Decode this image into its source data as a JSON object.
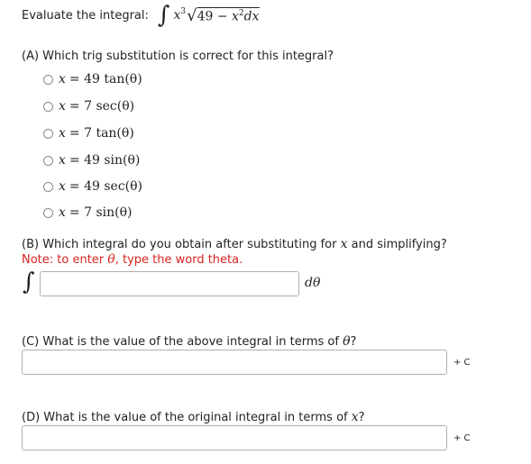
{
  "intro": {
    "label": "Evaluate the integral:",
    "integral_symbol": "∫",
    "var_x": "x",
    "exp3": "3",
    "radical": "√",
    "radicand_const": "49 − ",
    "var_x2": "x",
    "exp2": "2",
    "dx": "dx"
  },
  "partA": {
    "question": "(A) Which trig substitution is correct for this integral?",
    "options": [
      {
        "lhs": "x",
        "rhs": "= 49 tan(θ)"
      },
      {
        "lhs": "x",
        "rhs": "= 7 sec(θ)"
      },
      {
        "lhs": "x",
        "rhs": "= 7 tan(θ)"
      },
      {
        "lhs": "x",
        "rhs": "= 49 sin(θ)"
      },
      {
        "lhs": "x",
        "rhs": "= 49 sec(θ)"
      },
      {
        "lhs": "x",
        "rhs": "= 7 sin(θ)"
      }
    ]
  },
  "partB": {
    "question_pre": "(B) Which integral do you obtain after substituting for ",
    "question_var": "x",
    "question_post": " and simplifying?",
    "note_pre": "Note: to enter ",
    "note_theta": "θ",
    "note_post": ", type the word theta.",
    "integral_symbol": "∫",
    "input_value": "",
    "dtheta": "dθ"
  },
  "partC": {
    "question_pre": "(C) What is the value of the above integral in terms of ",
    "question_var": "θ",
    "question_post": "?",
    "input_value": "",
    "plus_c": "+ C"
  },
  "partD": {
    "question_pre": "(D) What is the value of the original integral in terms of ",
    "question_var": "x",
    "question_post": "?",
    "input_value": "",
    "plus_c": "+ C"
  }
}
